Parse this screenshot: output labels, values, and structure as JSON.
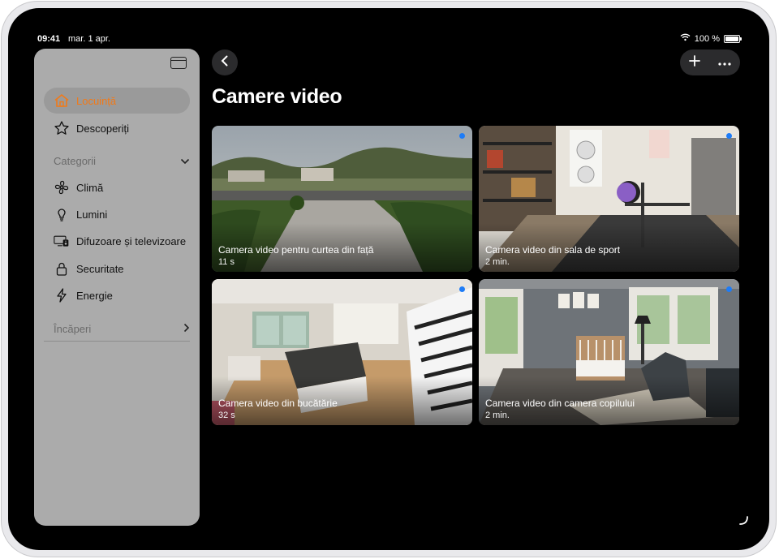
{
  "status": {
    "time": "09:41",
    "date": "mar. 1 apr.",
    "battery": "100 %",
    "battery_level": 1.0
  },
  "sidebar": {
    "items": [
      {
        "label": "Locuință",
        "icon": "house-icon",
        "active": true
      },
      {
        "label": "Descoperiți",
        "icon": "star-icon",
        "active": false
      }
    ],
    "categories_header": "Categorii",
    "categories": [
      {
        "label": "Climă",
        "icon": "fan-icon"
      },
      {
        "label": "Lumini",
        "icon": "lightbulb-icon"
      },
      {
        "label": "Difuzoare și televizoare",
        "icon": "tv-speaker-icon"
      },
      {
        "label": "Securitate",
        "icon": "lock-icon"
      },
      {
        "label": "Energie",
        "icon": "bolt-icon"
      }
    ],
    "rooms_header": "Încăperi"
  },
  "main": {
    "title": "Camere video",
    "cameras": [
      {
        "name": "Camera video pentru curtea din față",
        "time": "11 s"
      },
      {
        "name": "Camera video din sala de sport",
        "time": "2 min."
      },
      {
        "name": "Camera video din bucătărie",
        "time": "32 s"
      },
      {
        "name": "Camera video din camera copilului",
        "time": "2 min."
      }
    ]
  },
  "colors": {
    "accent": "#f07a1a",
    "live_dot": "#1e7cf7",
    "sidebar_bg": "#ababab"
  }
}
